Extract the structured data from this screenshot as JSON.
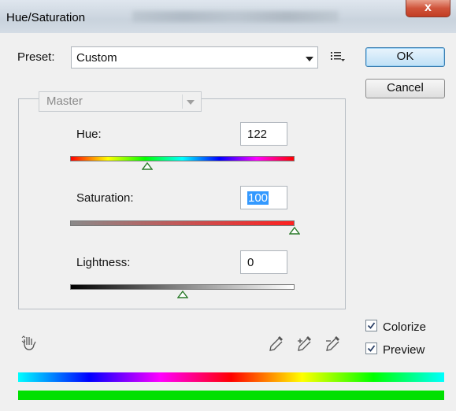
{
  "window": {
    "title": "Hue/Saturation",
    "close_label": "x"
  },
  "preset": {
    "label": "Preset:",
    "value": "Custom"
  },
  "buttons": {
    "ok": "OK",
    "cancel": "Cancel"
  },
  "channel": {
    "value": "Master"
  },
  "adjustments": {
    "hue": {
      "label": "Hue:",
      "value": "122"
    },
    "saturation": {
      "label": "Saturation:",
      "value": "100"
    },
    "lightness": {
      "label": "Lightness:",
      "value": "0"
    }
  },
  "options": {
    "colorize": {
      "label": "Colorize",
      "checked": true
    },
    "preview": {
      "label": "Preview",
      "checked": true
    }
  },
  "colors": {
    "ok_border": "#3c7fb1",
    "result_bar": "#00e000"
  }
}
